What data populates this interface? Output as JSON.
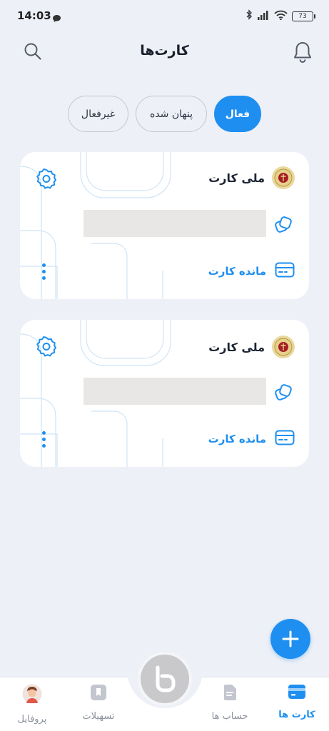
{
  "status_bar": {
    "time": "14:03",
    "battery": "73"
  },
  "header": {
    "title": "کارت‌ها"
  },
  "tabs": [
    {
      "label": "فعال",
      "active": true
    },
    {
      "label": "پنهان شده",
      "active": false
    },
    {
      "label": "غیرفعال",
      "active": false
    }
  ],
  "cards": [
    {
      "bank_name": "ملی کارت",
      "balance_label": "مانده کارت"
    },
    {
      "bank_name": "ملی کارت",
      "balance_label": "مانده کارت"
    }
  ],
  "bottom_nav": [
    {
      "label": "کارت ها",
      "icon": "card-icon",
      "active": true
    },
    {
      "label": "حساب ها",
      "icon": "document-icon",
      "active": false
    },
    {
      "label": "تسهیلات",
      "icon": "bookmark-icon",
      "active": false
    },
    {
      "label": "پروفایل",
      "icon": "avatar-icon",
      "active": false
    }
  ],
  "colors": {
    "accent": "#1e8ff0",
    "background": "#eef0f7"
  }
}
